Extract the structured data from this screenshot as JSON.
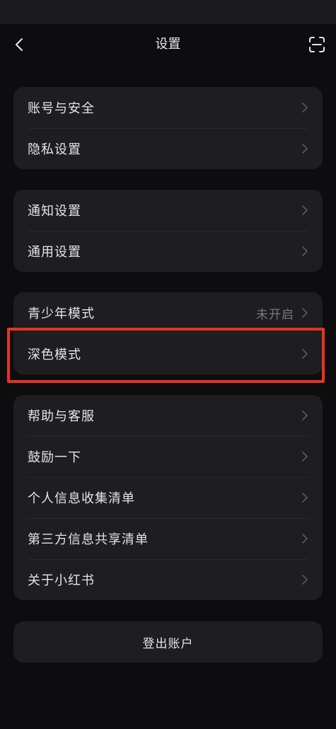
{
  "nav": {
    "title": "设置"
  },
  "groups": [
    {
      "items": [
        {
          "label": "账号与安全"
        },
        {
          "label": "隐私设置"
        }
      ]
    },
    {
      "items": [
        {
          "label": "通知设置"
        },
        {
          "label": "通用设置"
        }
      ]
    },
    {
      "items": [
        {
          "label": "青少年模式",
          "value": "未开启"
        },
        {
          "label": "深色模式"
        }
      ]
    },
    {
      "items": [
        {
          "label": "帮助与客服"
        },
        {
          "label": "鼓励一下"
        },
        {
          "label": "个人信息收集清单"
        },
        {
          "label": "第三方信息共享清单"
        },
        {
          "label": "关于小红书"
        }
      ]
    }
  ],
  "logout_label": "登出账户",
  "colors": {
    "background": "#0d0d0f",
    "card": "#1e1e21",
    "highlight_border": "#e8331f"
  },
  "icons": {
    "back": "chevron-left-icon",
    "scan": "scan-icon",
    "row_arrow": "chevron-right-icon"
  }
}
